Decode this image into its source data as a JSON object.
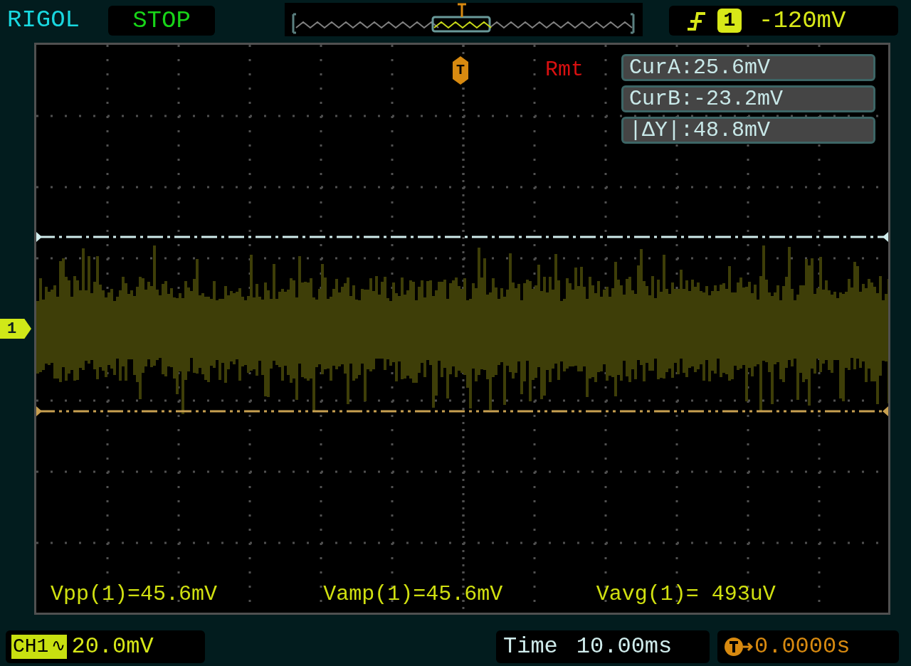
{
  "header": {
    "brand": "RIGOL",
    "run_state": "STOP"
  },
  "trigger": {
    "channel": "1",
    "level": "-120mV"
  },
  "trigger_marker": "T",
  "remote": "Rmt",
  "cursors": [
    "CurA:25.6mV",
    "CurB:-23.2mV",
    "|ΔY|:48.8mV"
  ],
  "channel_marker": "1",
  "measurements": [
    "Vpp(1)=45.6mV",
    "Vamp(1)=45.6mV",
    "Vavg(1)= 493uV"
  ],
  "footer": {
    "channel": "CH1",
    "coupling": "∿",
    "scale": "20.0mV",
    "time_label": "Time",
    "timebase": "10.00ms",
    "trigger_offset": "0.0000s"
  }
}
